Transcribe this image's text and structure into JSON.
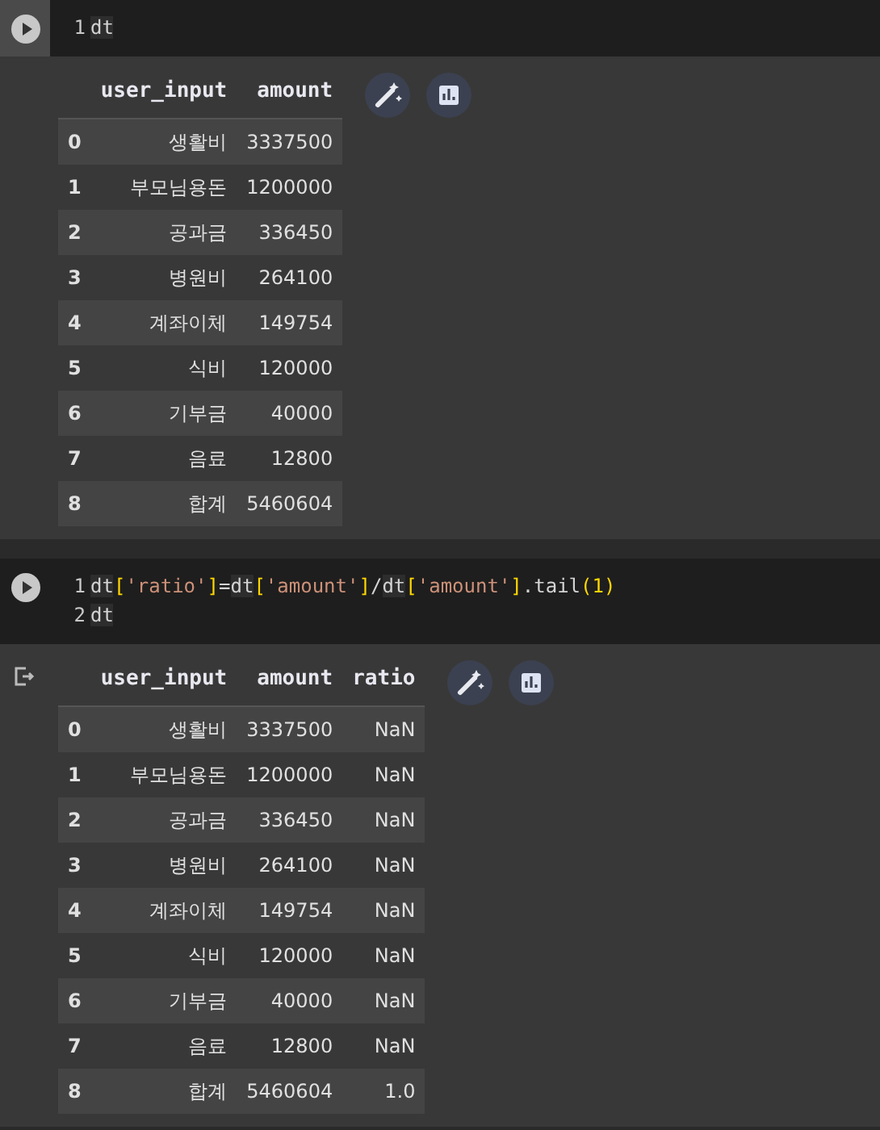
{
  "cells": [
    {
      "focused": true,
      "output_marker": false,
      "lines": [
        {
          "number": "1",
          "tokens": [
            {
              "kind": "var",
              "text": "dt"
            }
          ]
        }
      ],
      "table": {
        "columns": [
          "user_input",
          "amount"
        ],
        "rows": [
          {
            "index": "0",
            "cells": [
              "생활비",
              "3337500"
            ]
          },
          {
            "index": "1",
            "cells": [
              "부모님용돈",
              "1200000"
            ]
          },
          {
            "index": "2",
            "cells": [
              "공과금",
              "336450"
            ]
          },
          {
            "index": "3",
            "cells": [
              "병원비",
              "264100"
            ]
          },
          {
            "index": "4",
            "cells": [
              "계좌이체",
              "149754"
            ]
          },
          {
            "index": "5",
            "cells": [
              "식비",
              "120000"
            ]
          },
          {
            "index": "6",
            "cells": [
              "기부금",
              "40000"
            ]
          },
          {
            "index": "7",
            "cells": [
              "음료",
              "12800"
            ]
          },
          {
            "index": "8",
            "cells": [
              "합계",
              "5460604"
            ]
          }
        ]
      }
    },
    {
      "focused": false,
      "output_marker": true,
      "lines": [
        {
          "number": "1",
          "tokens": [
            {
              "kind": "var",
              "text": "dt"
            },
            {
              "kind": "bracket",
              "text": "["
            },
            {
              "kind": "string",
              "text": "'ratio'"
            },
            {
              "kind": "bracket",
              "text": "]"
            },
            {
              "kind": "plain",
              "text": "="
            },
            {
              "kind": "var",
              "text": "dt"
            },
            {
              "kind": "bracket",
              "text": "["
            },
            {
              "kind": "string",
              "text": "'amount'"
            },
            {
              "kind": "bracket",
              "text": "]"
            },
            {
              "kind": "plain",
              "text": "/"
            },
            {
              "kind": "var",
              "text": "dt"
            },
            {
              "kind": "bracket",
              "text": "["
            },
            {
              "kind": "string",
              "text": "'amount'"
            },
            {
              "kind": "bracket",
              "text": "]"
            },
            {
              "kind": "plain",
              "text": ".tail"
            },
            {
              "kind": "bracket",
              "text": "("
            },
            {
              "kind": "number",
              "text": "1"
            },
            {
              "kind": "bracket",
              "text": ")"
            }
          ]
        },
        {
          "number": "2",
          "tokens": [
            {
              "kind": "var",
              "text": "dt"
            }
          ]
        }
      ],
      "table": {
        "columns": [
          "user_input",
          "amount",
          "ratio"
        ],
        "rows": [
          {
            "index": "0",
            "cells": [
              "생활비",
              "3337500",
              "NaN"
            ]
          },
          {
            "index": "1",
            "cells": [
              "부모님용돈",
              "1200000",
              "NaN"
            ]
          },
          {
            "index": "2",
            "cells": [
              "공과금",
              "336450",
              "NaN"
            ]
          },
          {
            "index": "3",
            "cells": [
              "병원비",
              "264100",
              "NaN"
            ]
          },
          {
            "index": "4",
            "cells": [
              "계좌이체",
              "149754",
              "NaN"
            ]
          },
          {
            "index": "5",
            "cells": [
              "식비",
              "120000",
              "NaN"
            ]
          },
          {
            "index": "6",
            "cells": [
              "기부금",
              "40000",
              "NaN"
            ]
          },
          {
            "index": "7",
            "cells": [
              "음료",
              "12800",
              "NaN"
            ]
          },
          {
            "index": "8",
            "cells": [
              "합계",
              "5460604",
              "1.0"
            ]
          }
        ]
      }
    }
  ]
}
